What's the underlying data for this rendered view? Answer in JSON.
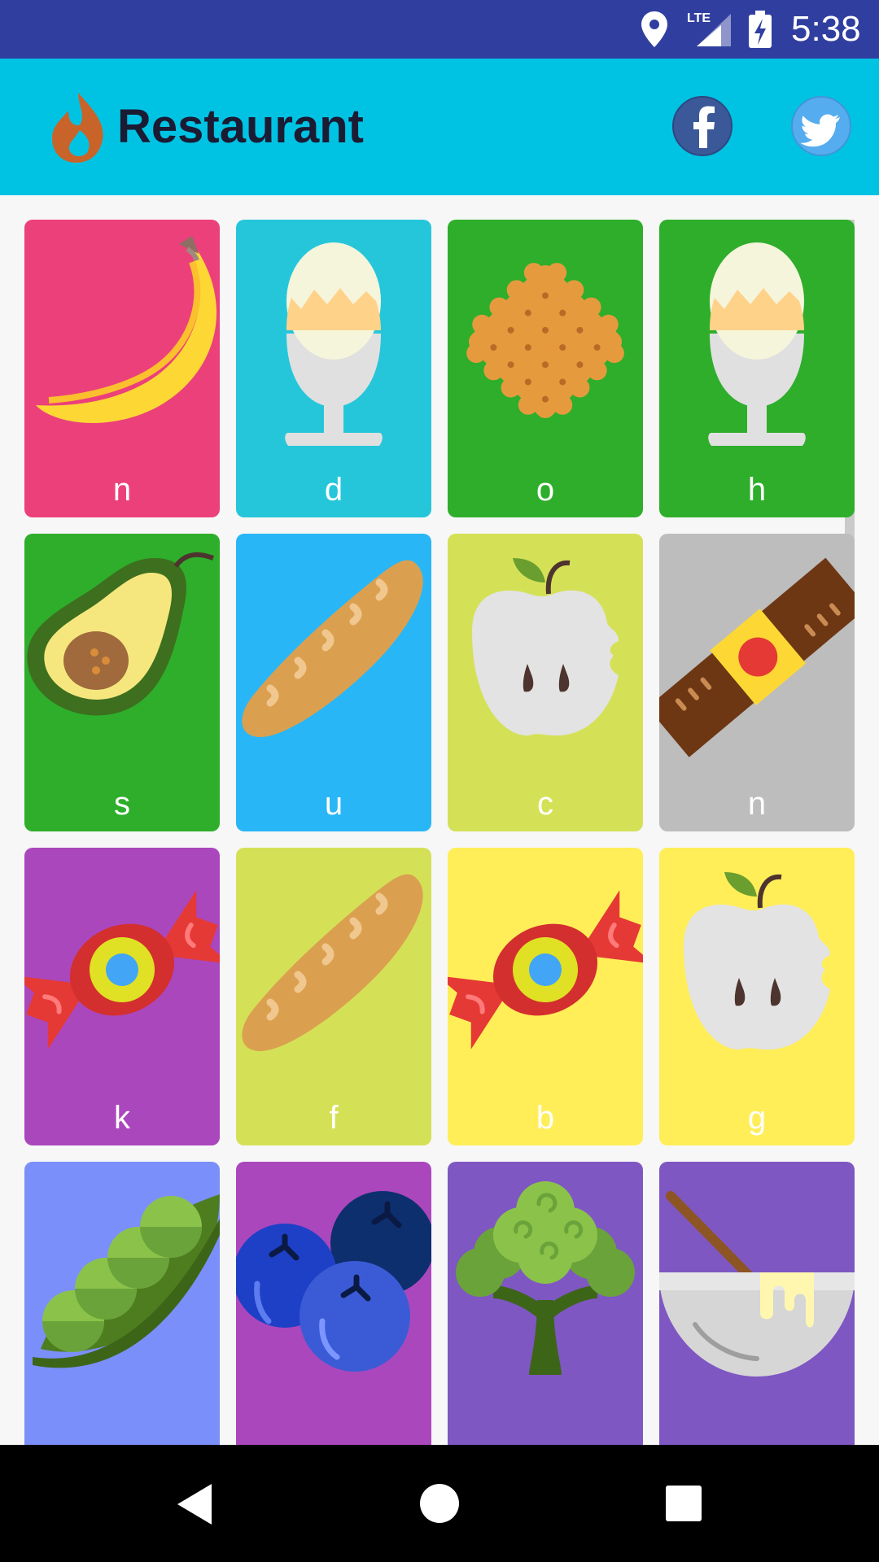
{
  "status_bar": {
    "time": "5:38",
    "network": "LTE",
    "icons": [
      "location-icon",
      "signal-icon",
      "battery-icon"
    ]
  },
  "app_bar": {
    "title": "Restaurant",
    "logo": "flame-icon",
    "social": [
      "facebook-icon",
      "twitter-icon"
    ]
  },
  "colors": {
    "status_bar": "#303f9f",
    "app_bar": "#00c3e3",
    "pink": "#ec407a",
    "cyan": "#26c6da",
    "green": "#2eae2b",
    "light_blue": "#29b6f6",
    "lime": "#d4e157",
    "grey": "#bdbdbd",
    "purple": "#ab47bc",
    "yellow": "#ffee58",
    "periwinkle": "#7b8ffa",
    "deep_purple": "#7e57c2"
  },
  "cards": [
    {
      "letter": "n",
      "icon": "banana-icon",
      "color": "#ec407a"
    },
    {
      "letter": "d",
      "icon": "boiled-egg-icon",
      "color": "#26c6da"
    },
    {
      "letter": "o",
      "icon": "cracker-icon",
      "color": "#2eae2b"
    },
    {
      "letter": "h",
      "icon": "boiled-egg-icon",
      "color": "#2eae2b"
    },
    {
      "letter": "s",
      "icon": "avocado-icon",
      "color": "#2eae2b"
    },
    {
      "letter": "u",
      "icon": "baguette-icon",
      "color": "#29b6f6"
    },
    {
      "letter": "c",
      "icon": "apple-icon",
      "color": "#d4e157"
    },
    {
      "letter": "n",
      "icon": "chocolate-bar-icon",
      "color": "#bdbdbd"
    },
    {
      "letter": "k",
      "icon": "candy-icon",
      "color": "#ab47bc"
    },
    {
      "letter": "f",
      "icon": "baguette-icon",
      "color": "#d4e157"
    },
    {
      "letter": "b",
      "icon": "candy-icon",
      "color": "#ffee58"
    },
    {
      "letter": "g",
      "icon": "apple-icon",
      "color": "#ffee58"
    },
    {
      "letter": "",
      "icon": "peas-icon",
      "color": "#7b8ffa"
    },
    {
      "letter": "",
      "icon": "blueberries-icon",
      "color": "#ab47bc"
    },
    {
      "letter": "",
      "icon": "broccoli-icon",
      "color": "#7e57c2"
    },
    {
      "letter": "",
      "icon": "mixing-bowl-icon",
      "color": "#7e57c2"
    }
  ]
}
